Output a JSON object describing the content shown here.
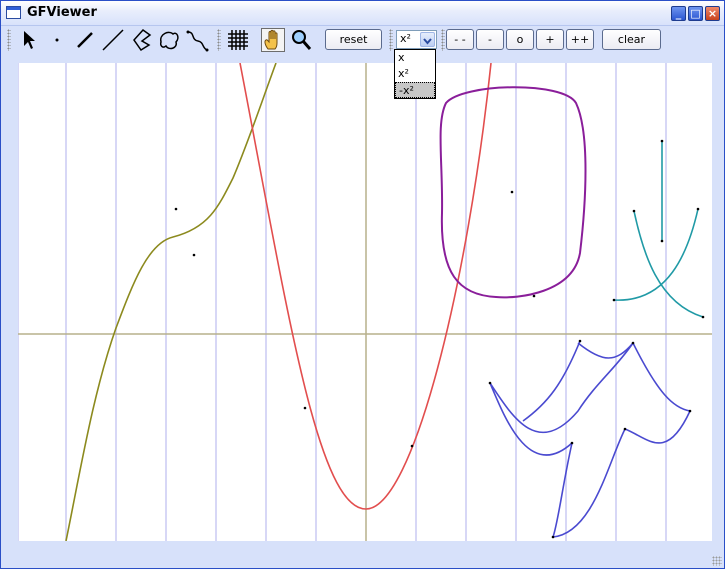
{
  "window": {
    "title": "GFViewer"
  },
  "toolbar": {
    "tools": [
      "pointer-tool",
      "point-tool",
      "segment-tool",
      "line-tool",
      "polygon-tool",
      "closed-curve-tool",
      "open-curve-tool",
      "grid-toggle",
      "pan-tool",
      "zoom-tool"
    ],
    "reset_label": "reset",
    "zoom_buttons": [
      "- -",
      "-",
      "o",
      "+",
      "++"
    ],
    "clear_label": "clear",
    "function_select": {
      "value": "x²",
      "options": [
        "x",
        "x²",
        "-x²"
      ],
      "highlighted": "-x²"
    }
  },
  "colors": {
    "cubic_curve": "#8c8a1e",
    "parabola": "#e24e4e",
    "closed_curve": "#8a1e9a",
    "teal_curve": "#209aa6",
    "blue_curve": "#4a4ad0",
    "axis": "#b7b08c",
    "grid": "#d7d7f6"
  }
}
